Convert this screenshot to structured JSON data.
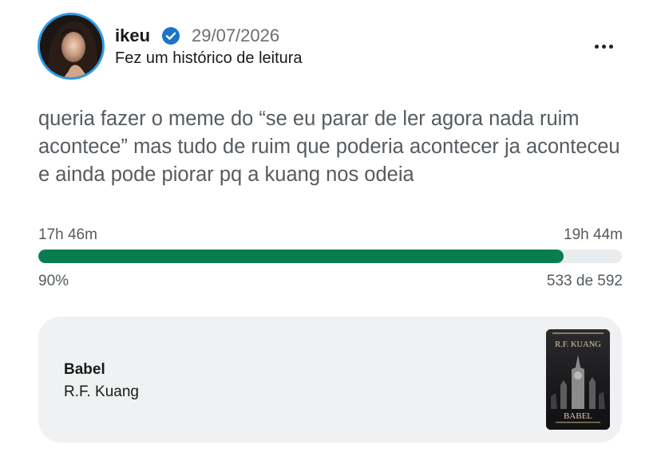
{
  "post": {
    "user": {
      "name": "ikeu",
      "verified": true,
      "date": "29/07/2026",
      "activity": "Fez um histórico de leitura"
    },
    "text": "queria fazer o meme do “se eu parar de ler agora nada ruim acontece” mas tudo de ruim que poderia acontecer ja aconteceu e ainda pode piorar pq a kuang nos odeia"
  },
  "progress": {
    "time_read": "17h 46m",
    "time_total": "19h 44m",
    "percent_label": "90%",
    "percent_value": 90,
    "pages_label": "533 de 592"
  },
  "book": {
    "title": "Babel",
    "author": "R.F. Kuang",
    "cover": {
      "author_text": "R.F. KUANG",
      "title_text": "BABEL"
    }
  },
  "icons": {
    "verified": "verified-badge-icon",
    "more": "more-options-icon"
  },
  "colors": {
    "accent_green": "#087d52",
    "verified_blue": "#1d73c9",
    "avatar_ring": "#2d9be6",
    "card_bg": "#eff1f2"
  }
}
